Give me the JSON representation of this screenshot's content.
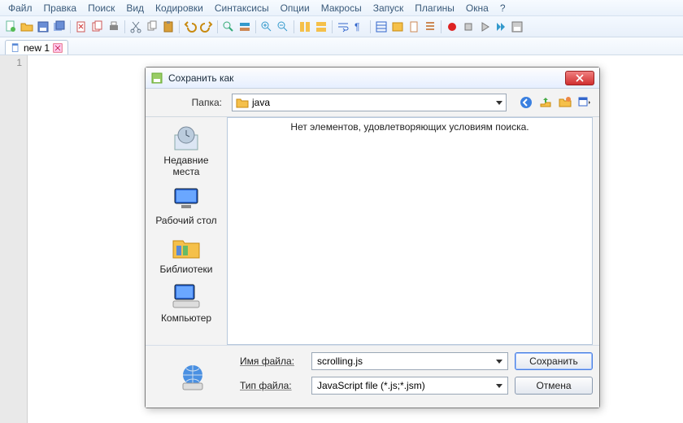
{
  "menubar": [
    "Файл",
    "Правка",
    "Поиск",
    "Вид",
    "Кодировки",
    "Синтаксисы",
    "Опции",
    "Макросы",
    "Запуск",
    "Плагины",
    "Окна",
    "?"
  ],
  "tab": {
    "label": "new 1"
  },
  "editor": {
    "line1": "1"
  },
  "dialog": {
    "title": "Сохранить как",
    "folder_label": "Папка:",
    "folder_value": "java",
    "empty_message": "Нет элементов, удовлетворяющих условиям поиска.",
    "nav": {
      "recent": "Недавние места",
      "desktop": "Рабочий стол",
      "libraries": "Библиотеки",
      "computer": "Компьютер"
    },
    "filename_label": "Имя файла:",
    "filename_value": "scrolling.js",
    "filetype_label": "Тип файла:",
    "filetype_value": "JavaScript file (*.js;*.jsm)",
    "save_btn": "Сохранить",
    "cancel_btn": "Отмена"
  }
}
